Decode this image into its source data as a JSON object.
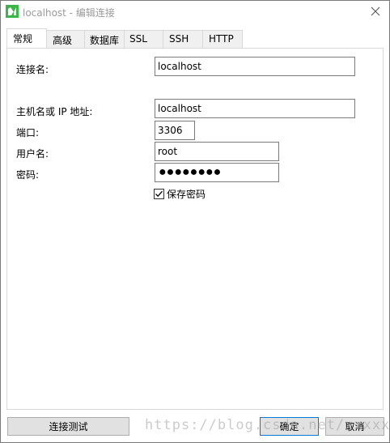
{
  "window": {
    "title": "localhost - 编辑连接"
  },
  "tabs": [
    {
      "label": "常规",
      "active": true
    },
    {
      "label": "高级",
      "active": false
    },
    {
      "label": "数据库",
      "active": false
    },
    {
      "label": "SSL",
      "active": false
    },
    {
      "label": "SSH",
      "active": false
    },
    {
      "label": "HTTP",
      "active": false
    }
  ],
  "form": {
    "connection_name_label": "连接名:",
    "connection_name_value": "localhost",
    "host_label": "主机名或 IP 地址:",
    "host_value": "localhost",
    "port_label": "端口:",
    "port_value": "3306",
    "user_label": "用户名:",
    "user_value": "root",
    "password_label": "密码:",
    "password_mask": "●●●●●●●●",
    "save_password_label": "保存密码",
    "save_password_checked": true
  },
  "buttons": {
    "test_label": "连接测试",
    "ok_label": "确定",
    "cancel_label": "取消"
  },
  "watermark": "https://blog.csdn.net/xxxxxly",
  "colors": {
    "app_icon_green": "#3cb44a",
    "default_button_border": "#0078d7"
  }
}
